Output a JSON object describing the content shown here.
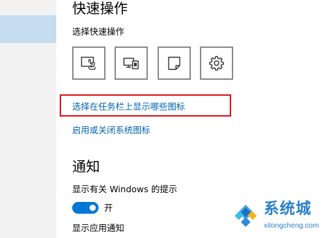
{
  "quick_actions": {
    "title": "快速操作",
    "subtitle": "选择快速操作",
    "buttons": [
      {
        "icon": "tablet-mode-icon"
      },
      {
        "icon": "project-icon"
      },
      {
        "icon": "note-icon"
      },
      {
        "icon": "settings-icon"
      }
    ]
  },
  "links": {
    "taskbar_icons": "选择在任务栏上显示哪些图标",
    "system_icons": "启用或关闭系统图标"
  },
  "notifications": {
    "title": "通知",
    "windows_tips_label": "显示有关 Windows 的提示",
    "toggle_state": "开",
    "app_notifications_label": "显示应用通知"
  },
  "watermark": {
    "text": "系统城",
    "url": "xitongcheng.com"
  },
  "colors": {
    "link": "#0063b1",
    "accent": "#0078d7",
    "highlight": "#e0101a",
    "watermark": "#2a7fc8"
  }
}
